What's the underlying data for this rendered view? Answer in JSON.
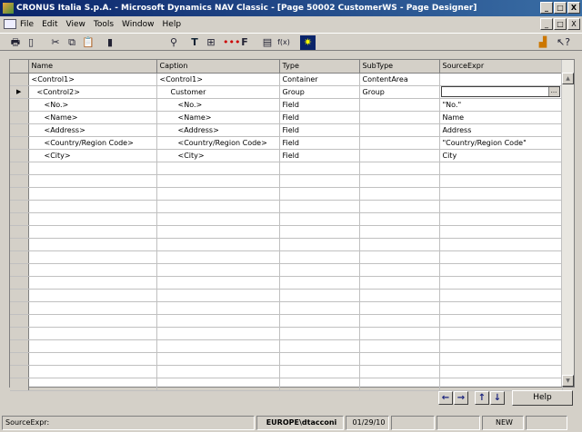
{
  "window": {
    "title": "CRONUS Italia S.p.A. - Microsoft Dynamics NAV Classic - [Page 50002 CustomerWS - Page Designer]",
    "minimize": "_",
    "restore": "□",
    "close": "X"
  },
  "menu": [
    "File",
    "Edit",
    "View",
    "Tools",
    "Window",
    "Help"
  ],
  "toolbar": {
    "fx_label": "f(x)",
    "f_label": "F",
    "t_label": "T"
  },
  "grid": {
    "columns": [
      "Name",
      "Caption",
      "Type",
      "SubType",
      "SourceExpr"
    ],
    "rows": [
      {
        "name": "<Control1>",
        "caption": "<Control1>",
        "type": "Container",
        "subtype": "ContentArea",
        "source": ""
      },
      {
        "name": "<Control2>",
        "caption": "Customer",
        "type": "Group",
        "subtype": "Group",
        "source": ""
      },
      {
        "name": "<No.>",
        "caption": "<No.>",
        "type": "Field",
        "subtype": "",
        "source": "\"No.\""
      },
      {
        "name": "<Name>",
        "caption": "<Name>",
        "type": "Field",
        "subtype": "",
        "source": "Name"
      },
      {
        "name": "<Address>",
        "caption": "<Address>",
        "type": "Field",
        "subtype": "",
        "source": "Address"
      },
      {
        "name": "<Country/Region Code>",
        "caption": "<Country/Region Code>",
        "type": "Field",
        "subtype": "",
        "source": "\"Country/Region Code\""
      },
      {
        "name": "<City>",
        "caption": "<City>",
        "type": "Field",
        "subtype": "",
        "source": "City"
      }
    ],
    "current_row_marker": "▶",
    "ellipsis": "..."
  },
  "buttons": {
    "left": "←",
    "right": "→",
    "up": "↑",
    "down": "↓",
    "help": "Help"
  },
  "status": {
    "field": "SourceExpr:",
    "user": "EUROPE\\dtacconi",
    "date": "01/29/10",
    "mode": "NEW"
  }
}
